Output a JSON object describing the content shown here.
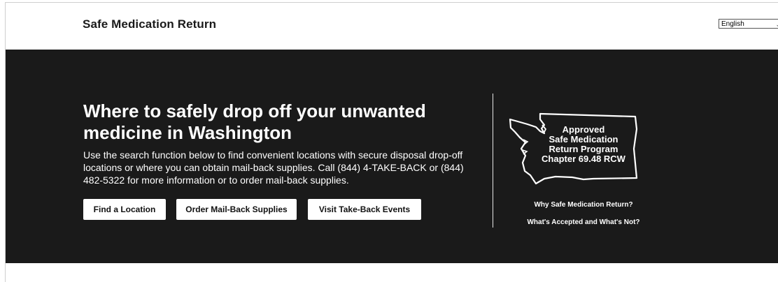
{
  "header": {
    "site_title": "Safe Medication Return",
    "language": {
      "selected": "English"
    }
  },
  "hero": {
    "title": "Where to safely drop off your unwanted medicine in Washington",
    "description": "Use the search function below to find convenient locations with secure disposal drop-off locations or where you can obtain mail-back supplies. Call (844) 4-TAKE-BACK or (844) 482-5322 for more information or to order mail-back supplies.",
    "buttons": {
      "find": "Find a Location",
      "order": "Order Mail-Back Supplies",
      "events": "Visit Take-Back Events"
    }
  },
  "badge": {
    "lines": [
      "Approved",
      "Safe Medication",
      "Return Program",
      "Chapter 69.48 RCW"
    ]
  },
  "side_links": {
    "why": "Why Safe Medication Return?",
    "accepted": "What's Accepted and What's Not?"
  },
  "colors": {
    "hero_background": "#1a1a1a",
    "button_background": "#ffffff",
    "text_light": "#ffffff",
    "text_dark": "#1a1a1a"
  }
}
